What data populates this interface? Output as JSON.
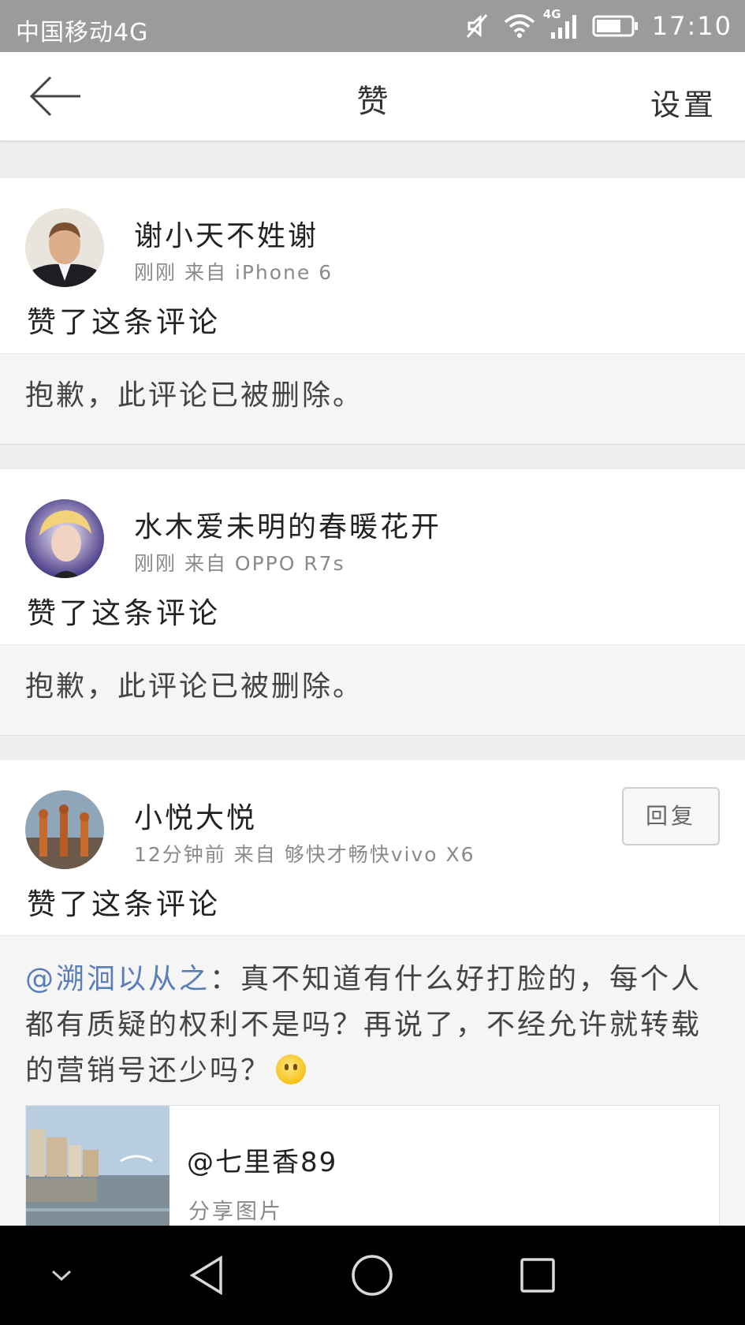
{
  "status_bar": {
    "carrier": "中国移动4G",
    "network_badge": "4G",
    "time": "17:10",
    "icons": [
      "mute-icon",
      "wifi-icon",
      "signal-icon",
      "battery-icon"
    ]
  },
  "header": {
    "title": "赞",
    "settings_label": "设置",
    "back_icon": "arrow-left-icon"
  },
  "feed": [
    {
      "user": "谢小天不姓谢",
      "meta": "刚刚  来自 iPhone 6",
      "action": "赞了这条评论",
      "deleted_text": "抱歉，此评论已被删除。"
    },
    {
      "user": "水木爱未明的春暖花开",
      "meta": "刚刚  来自 OPPO R7s",
      "action": "赞了这条评论",
      "deleted_text": "抱歉，此评论已被删除。"
    },
    {
      "user": "小悦大悦",
      "meta": "12分钟前  来自  够快才畅快vivo X6",
      "action": "赞了这条评论",
      "reply_label": "回复",
      "comment": {
        "mention": "@溯洄以从之",
        "text": "：真不知道有什么好打脸的，每个人都有质疑的权利不是吗？再说了，不经允许就转载的营销号还少吗？",
        "emoji": "smile-emoji"
      },
      "share": {
        "user": "@七里香89",
        "subtitle": "分享图片"
      }
    }
  ],
  "system_nav": [
    "chevron-down-icon",
    "back-triangle-icon",
    "home-circle-icon",
    "recents-square-icon"
  ]
}
